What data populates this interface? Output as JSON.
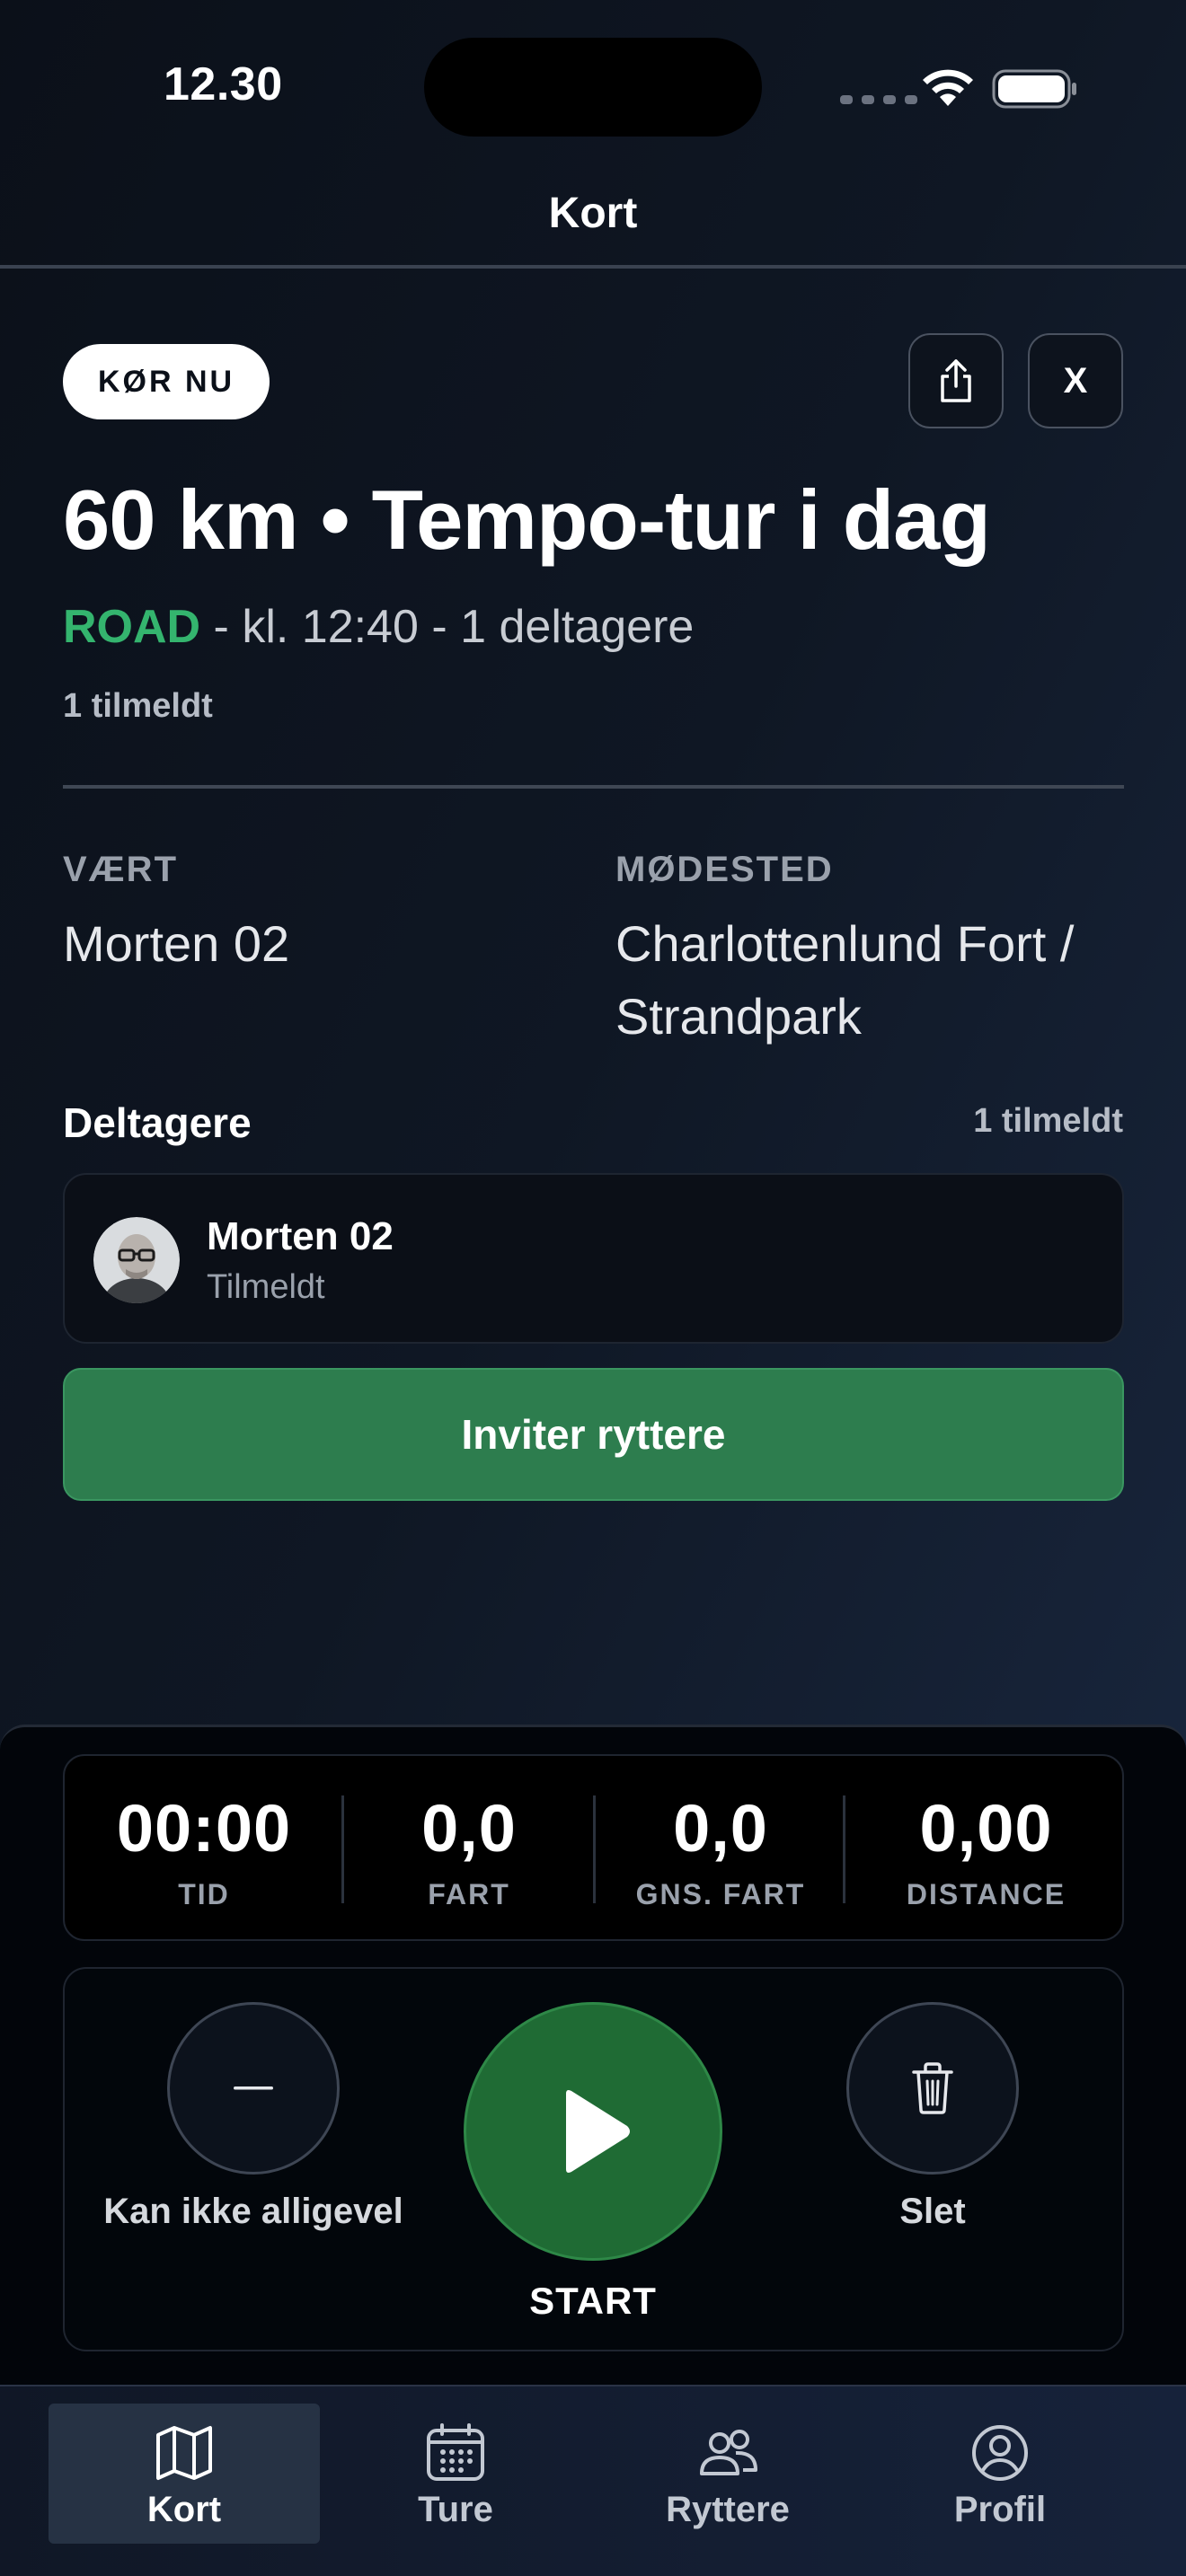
{
  "status_bar": {
    "time": "12.30"
  },
  "header": {
    "title": "Kort"
  },
  "ride": {
    "badge": "KØR NU",
    "close_label": "X",
    "title": "60 km • Tempo-tur i dag",
    "type": "ROAD",
    "details": " - kl. 12:40 - 1 deltagere",
    "registered": "1 tilmeldt",
    "host_label": "VÆRT",
    "host_value": "Morten 02",
    "meeting_label": "MØDESTED",
    "meeting_value": "Charlottenlund Fort / Strandpark"
  },
  "participants": {
    "title": "Deltagere",
    "count": "1 tilmeldt",
    "items": [
      {
        "name": "Morten 02",
        "status": "Tilmeldt"
      }
    ],
    "invite_label": "Inviter ryttere"
  },
  "stats": [
    {
      "value": "00:00",
      "label": "TID"
    },
    {
      "value": "0,0",
      "label": "FART"
    },
    {
      "value": "0,0",
      "label": "GNS. FART"
    },
    {
      "value": "0,00",
      "label": "DISTANCE"
    }
  ],
  "controls": {
    "cant_label": "Kan ikke alligevel",
    "start_label": "START",
    "delete_label": "Slet"
  },
  "tabs": [
    {
      "label": "Kort",
      "icon": "map-icon",
      "active": true
    },
    {
      "label": "Ture",
      "icon": "calendar-icon",
      "active": false
    },
    {
      "label": "Ryttere",
      "icon": "people-icon",
      "active": false
    },
    {
      "label": "Profil",
      "icon": "profile-icon",
      "active": false
    }
  ],
  "colors": {
    "accent_green": "#2d7d4e",
    "road_green": "#34b46e",
    "start_green": "#1f6b34"
  }
}
